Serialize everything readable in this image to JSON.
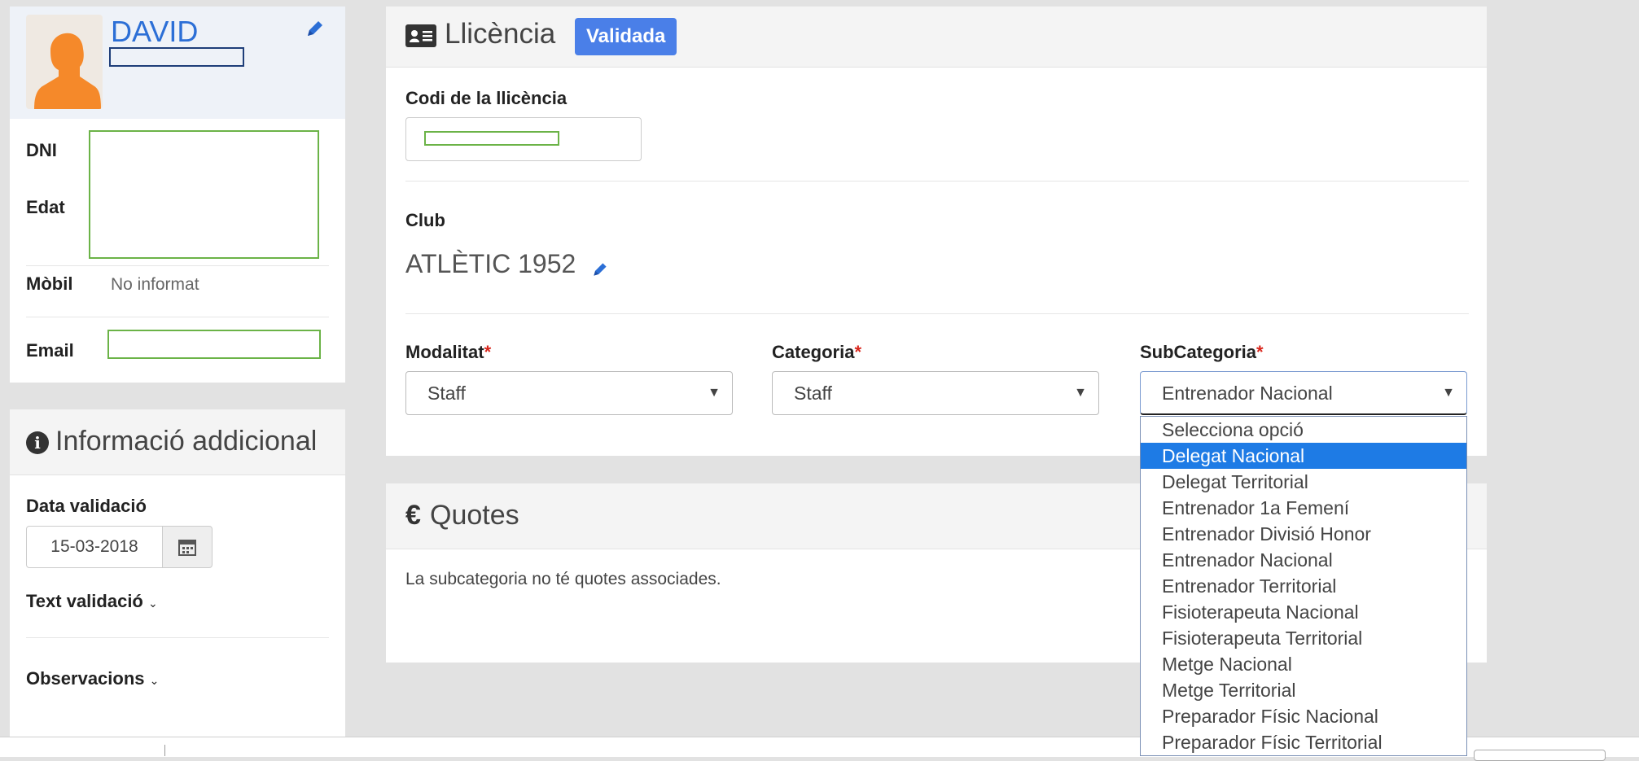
{
  "profile": {
    "name": "DAVID",
    "fields": [
      {
        "label": "DNI"
      },
      {
        "label": "Edat"
      },
      {
        "label": "Mòbil",
        "value": "No informat"
      },
      {
        "label": "Email"
      }
    ]
  },
  "additional": {
    "title": "Informació addicional",
    "date_label": "Data validació",
    "date_value": "15-03-2018",
    "text_validation": "Text validació",
    "observations": "Observacions"
  },
  "licence": {
    "title": "Llicència",
    "status": "Validada",
    "code_label": "Codi de la llicència",
    "club_label": "Club",
    "club_name": "ATLÈTIC 1952",
    "modalitat_label": "Modalitat",
    "modalitat_value": "Staff",
    "categoria_label": "Categoria",
    "categoria_value": "Staff",
    "subcategoria_label": "SubCategoria",
    "subcategoria_value": "Entrenador Nacional",
    "required_mark": "*"
  },
  "dropdown": {
    "options": [
      "Selecciona opció",
      "Delegat Nacional",
      "Delegat Territorial",
      "Entrenador 1a Femení",
      "Entrenador Divisió Honor",
      "Entrenador Nacional",
      "Entrenador Territorial",
      "Fisioterapeuta Nacional",
      "Fisioterapeuta Territorial",
      "Metge Nacional",
      "Metge Territorial",
      "Preparador Físic Nacional",
      "Preparador Físic Territorial"
    ],
    "highlighted": "Delegat Nacional"
  },
  "quotes": {
    "title": "Quotes",
    "empty_text": "La subcategoria no té quotes associades."
  },
  "colors": {
    "accent": "#4a7fe8",
    "link": "#2c6fd6",
    "green_outline": "#6bb347",
    "highlight": "#1e7be5"
  },
  "icons": {
    "licence": "id-card-icon",
    "info": "info-circle-icon",
    "euro": "euro-icon",
    "calendar": "calendar-icon",
    "edit": "pencil-icon",
    "chevron": "chevron-down-icon"
  }
}
